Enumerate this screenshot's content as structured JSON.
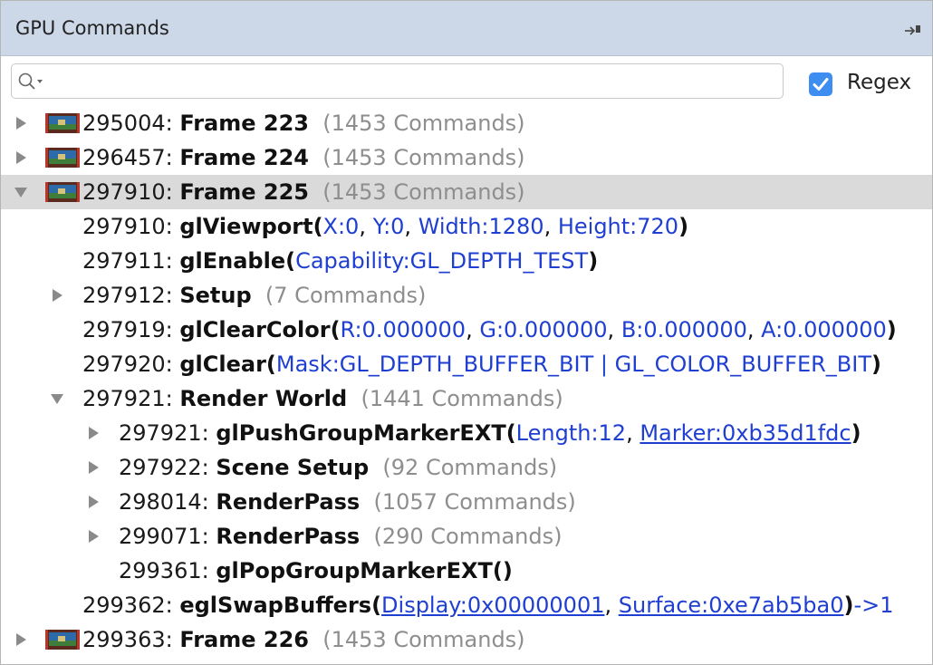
{
  "panel": {
    "title": "GPU Commands"
  },
  "search": {
    "value": "",
    "placeholder": "",
    "regex_label": "Regex",
    "regex_checked": true
  },
  "colors": {
    "titlebar": "#ccd7e7",
    "selected_row": "#dadada",
    "argument": "#1f3fd1",
    "count": "#8e8e8e",
    "checkbox": "#3d8ef0"
  },
  "rows": [
    {
      "id": "295004:",
      "name": "Frame 223",
      "count": "(1453 Commands)",
      "expander": "collapsed",
      "thumbnail": true,
      "selected": false
    },
    {
      "id": "296457:",
      "name": "Frame 224",
      "count": "(1453 Commands)",
      "expander": "collapsed",
      "thumbnail": true,
      "selected": false
    },
    {
      "id": "297910:",
      "name": "Frame 225",
      "count": "(1453 Commands)",
      "expander": "expanded",
      "thumbnail": true,
      "selected": true
    },
    {
      "id": "297910:",
      "name": "glViewport",
      "open": "(",
      "args": [
        {
          "text": "X:0",
          "link": false
        },
        {
          "text": ", ",
          "plain": true
        },
        {
          "text": "Y:0",
          "link": false
        },
        {
          "text": ", ",
          "plain": true
        },
        {
          "text": "Width:1280",
          "link": false
        },
        {
          "text": ", ",
          "plain": true
        },
        {
          "text": "Height:720",
          "link": false
        }
      ],
      "close": ")"
    },
    {
      "id": "297911:",
      "name": "glEnable",
      "open": "(",
      "args": [
        {
          "text": "Capability:GL_DEPTH_TEST",
          "link": false
        }
      ],
      "close": ")"
    },
    {
      "id": "297912:",
      "name": "Setup",
      "count": "(7 Commands)",
      "expander": "collapsed"
    },
    {
      "id": "297919:",
      "name": "glClearColor",
      "open": "(",
      "args": [
        {
          "text": "R:0.000000",
          "link": false
        },
        {
          "text": ", ",
          "plain": true
        },
        {
          "text": "G:0.000000",
          "link": false
        },
        {
          "text": ", ",
          "plain": true
        },
        {
          "text": "B:0.000000",
          "link": false
        },
        {
          "text": ", ",
          "plain": true
        },
        {
          "text": "A:0.000000",
          "link": false
        }
      ],
      "close": ")"
    },
    {
      "id": "297920:",
      "name": "glClear",
      "open": "(",
      "args": [
        {
          "text": "Mask:GL_DEPTH_BUFFER_BIT | GL_COLOR_BUFFER_BIT",
          "link": false
        }
      ],
      "close": ")"
    },
    {
      "id": "297921:",
      "name": "Render World",
      "count": "(1441 Commands)",
      "expander": "expanded"
    },
    {
      "id": "297921:",
      "name": "glPushGroupMarkerEXT",
      "open": "(",
      "args": [
        {
          "text": "Length:12",
          "link": false
        },
        {
          "text": ", ",
          "plain": true
        },
        {
          "text": "Marker:0xb35d1fdc",
          "link": true
        }
      ],
      "close": ")",
      "expander": "collapsed"
    },
    {
      "id": "297922:",
      "name": "Scene Setup",
      "count": "(92 Commands)",
      "expander": "collapsed"
    },
    {
      "id": "298014:",
      "name": "RenderPass",
      "count": "(1057 Commands)",
      "expander": "collapsed"
    },
    {
      "id": "299071:",
      "name": "RenderPass",
      "count": "(290 Commands)",
      "expander": "collapsed"
    },
    {
      "id": "299361:",
      "name": "glPopGroupMarkerEXT()",
      "open": "",
      "args": [],
      "close": ""
    },
    {
      "id": "299362:",
      "name": "eglSwapBuffers",
      "open": "(",
      "args": [
        {
          "text": "Display:0x00000001",
          "link": true
        },
        {
          "text": ", ",
          "plain": true
        },
        {
          "text": "Surface:0xe7ab5ba0",
          "link": true
        }
      ],
      "close": ")",
      "result": "->1"
    },
    {
      "id": "299363:",
      "name": "Frame 226",
      "count": "(1453 Commands)",
      "expander": "collapsed",
      "thumbnail": true,
      "selected": false
    }
  ]
}
